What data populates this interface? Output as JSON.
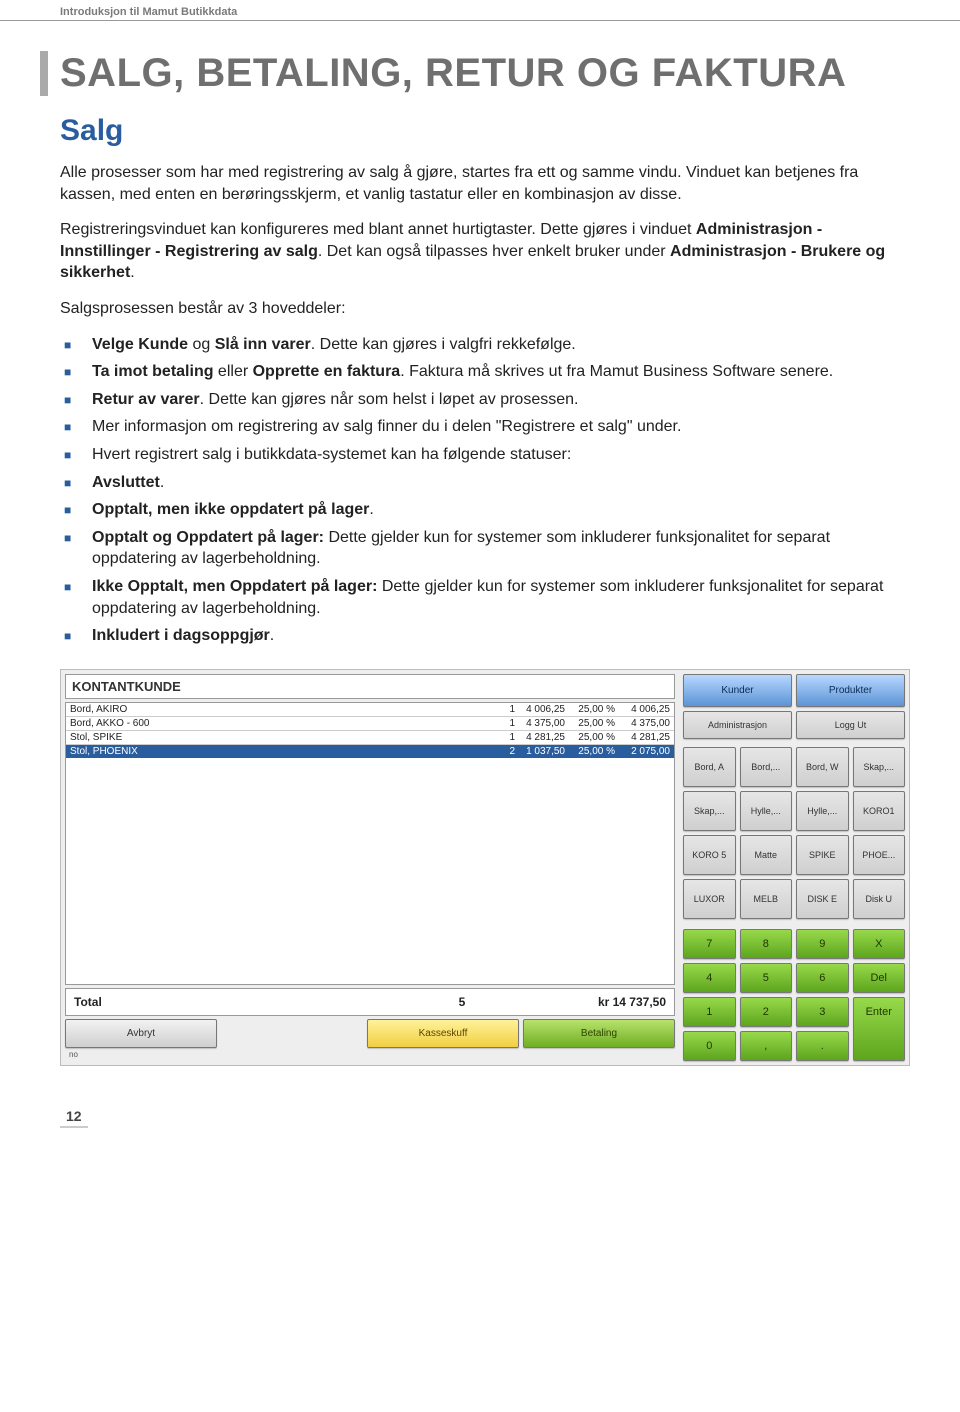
{
  "header": "Introduksjon til Mamut Butikkdata",
  "title": "SALG, BETALING, RETUR OG FAKTURA",
  "subtitle": "Salg",
  "para1": "Alle prosesser som har med registrering av salg å gjøre, startes fra ett og samme vindu. Vinduet kan betjenes fra kassen, med enten en berøringsskjerm, et vanlig tastatur eller en kombinasjon av disse.",
  "para2a": "Registreringsvinduet kan konfigureres med blant annet hurtigtaster. Dette gjøres i vinduet ",
  "para2b": "Administrasjon - Innstillinger - Registrering av salg",
  "para2c": ". Det kan også tilpasses hver enkelt bruker under ",
  "para2d": "Administrasjon - Brukere og sikkerhet",
  "para2e": ".",
  "para3": "Salgsprosessen består av 3 hoveddeler:",
  "bullets": {
    "b1a": "Velge Kunde",
    "b1b": " og ",
    "b1c": "Slå inn varer",
    "b1d": ". Dette kan gjøres i valgfri rekkefølge.",
    "b2a": "Ta imot betaling",
    "b2b": " eller ",
    "b2c": "Opprette en faktura",
    "b2d": ". Faktura må skrives ut fra Mamut Business Software senere.",
    "b3a": "Retur av varer",
    "b3b": ". Dette kan gjøres når som helst i løpet av prosessen.",
    "b4": "Mer informasjon om registrering av salg finner du i delen \"Registrere et salg\" under.",
    "b5": "Hvert registrert salg i butikkdata-systemet kan ha følgende statuser:",
    "b6": "Avsluttet",
    "b7": "Opptalt, men ikke oppdatert på lager",
    "b8a": "Opptalt og Oppdatert på lager:",
    "b8b": " Dette gjelder kun for systemer som inkluderer funksjonalitet for separat oppdatering av lagerbeholdning.",
    "b9a": "Ikke Opptalt, men Oppdatert på lager:",
    "b9b": " Dette gjelder kun for systemer som inkluderer funksjonalitet for separat oppdatering av lagerbeholdning.",
    "b10": "Inkludert i dagsoppgjør"
  },
  "screenshot": {
    "customer": "KONTANTKUNDE",
    "rows": [
      {
        "name": "Bord, AKIRO",
        "qty": "1",
        "unit": "4 006,25",
        "pct": "25,00 %",
        "total": "4 006,25"
      },
      {
        "name": "Bord, AKKO - 600",
        "qty": "1",
        "unit": "4 375,00",
        "pct": "25,00 %",
        "total": "4 375,00"
      },
      {
        "name": "Stol, SPIKE",
        "qty": "1",
        "unit": "4 281,25",
        "pct": "25,00 %",
        "total": "4 281,25"
      },
      {
        "name": "Stol, PHOENIX",
        "qty": "2",
        "unit": "1 037,50",
        "pct": "25,00 %",
        "total": "2 075,00"
      }
    ],
    "total_label": "Total",
    "total_qty": "5",
    "total_amount": "kr 14 737,50",
    "bottom": {
      "avbryt": "Avbryt",
      "kasseskuff": "Kasseskuff",
      "betaling": "Betaling"
    },
    "status": "no",
    "top_buttons": {
      "kunder": "Kunder",
      "produkter": "Produkter",
      "admin": "Administrasjon",
      "loggut": "Logg Ut"
    },
    "products": [
      "Bord, A",
      "Bord,...",
      "Bord, W",
      "Skap,...",
      "Skap,...",
      "Hylle,...",
      "Hylle,...",
      "KORO1",
      "KORO 5",
      "Matte",
      "SPIKE",
      "PHOE...",
      "LUXOR",
      "MELB",
      "DISK E",
      "Disk U"
    ],
    "keypad": [
      "7",
      "8",
      "9",
      "X",
      "4",
      "5",
      "6",
      "Del",
      "1",
      "2",
      "3",
      "Enter",
      "0",
      ",",
      ".",
      ""
    ]
  },
  "pagenum": "12"
}
